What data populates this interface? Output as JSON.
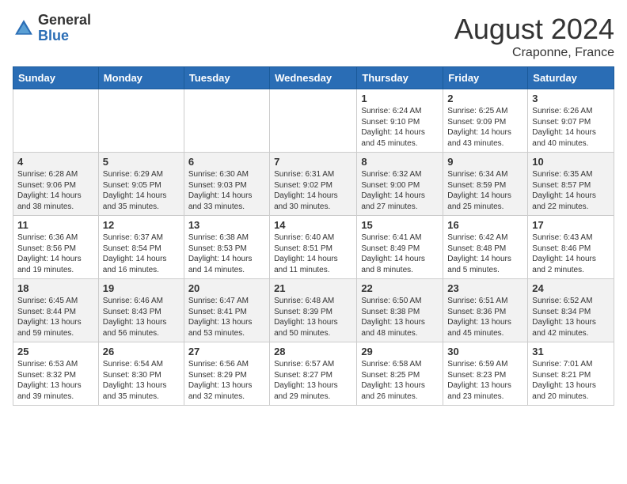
{
  "header": {
    "logo_general": "General",
    "logo_blue": "Blue",
    "month_year": "August 2024",
    "location": "Craponne, France"
  },
  "days_of_week": [
    "Sunday",
    "Monday",
    "Tuesday",
    "Wednesday",
    "Thursday",
    "Friday",
    "Saturday"
  ],
  "weeks": [
    [
      {
        "day": "",
        "content": ""
      },
      {
        "day": "",
        "content": ""
      },
      {
        "day": "",
        "content": ""
      },
      {
        "day": "",
        "content": ""
      },
      {
        "day": "1",
        "content": "Sunrise: 6:24 AM\nSunset: 9:10 PM\nDaylight: 14 hours and 45 minutes."
      },
      {
        "day": "2",
        "content": "Sunrise: 6:25 AM\nSunset: 9:09 PM\nDaylight: 14 hours and 43 minutes."
      },
      {
        "day": "3",
        "content": "Sunrise: 6:26 AM\nSunset: 9:07 PM\nDaylight: 14 hours and 40 minutes."
      }
    ],
    [
      {
        "day": "4",
        "content": "Sunrise: 6:28 AM\nSunset: 9:06 PM\nDaylight: 14 hours and 38 minutes."
      },
      {
        "day": "5",
        "content": "Sunrise: 6:29 AM\nSunset: 9:05 PM\nDaylight: 14 hours and 35 minutes."
      },
      {
        "day": "6",
        "content": "Sunrise: 6:30 AM\nSunset: 9:03 PM\nDaylight: 14 hours and 33 minutes."
      },
      {
        "day": "7",
        "content": "Sunrise: 6:31 AM\nSunset: 9:02 PM\nDaylight: 14 hours and 30 minutes."
      },
      {
        "day": "8",
        "content": "Sunrise: 6:32 AM\nSunset: 9:00 PM\nDaylight: 14 hours and 27 minutes."
      },
      {
        "day": "9",
        "content": "Sunrise: 6:34 AM\nSunset: 8:59 PM\nDaylight: 14 hours and 25 minutes."
      },
      {
        "day": "10",
        "content": "Sunrise: 6:35 AM\nSunset: 8:57 PM\nDaylight: 14 hours and 22 minutes."
      }
    ],
    [
      {
        "day": "11",
        "content": "Sunrise: 6:36 AM\nSunset: 8:56 PM\nDaylight: 14 hours and 19 minutes."
      },
      {
        "day": "12",
        "content": "Sunrise: 6:37 AM\nSunset: 8:54 PM\nDaylight: 14 hours and 16 minutes."
      },
      {
        "day": "13",
        "content": "Sunrise: 6:38 AM\nSunset: 8:53 PM\nDaylight: 14 hours and 14 minutes."
      },
      {
        "day": "14",
        "content": "Sunrise: 6:40 AM\nSunset: 8:51 PM\nDaylight: 14 hours and 11 minutes."
      },
      {
        "day": "15",
        "content": "Sunrise: 6:41 AM\nSunset: 8:49 PM\nDaylight: 14 hours and 8 minutes."
      },
      {
        "day": "16",
        "content": "Sunrise: 6:42 AM\nSunset: 8:48 PM\nDaylight: 14 hours and 5 minutes."
      },
      {
        "day": "17",
        "content": "Sunrise: 6:43 AM\nSunset: 8:46 PM\nDaylight: 14 hours and 2 minutes."
      }
    ],
    [
      {
        "day": "18",
        "content": "Sunrise: 6:45 AM\nSunset: 8:44 PM\nDaylight: 13 hours and 59 minutes."
      },
      {
        "day": "19",
        "content": "Sunrise: 6:46 AM\nSunset: 8:43 PM\nDaylight: 13 hours and 56 minutes."
      },
      {
        "day": "20",
        "content": "Sunrise: 6:47 AM\nSunset: 8:41 PM\nDaylight: 13 hours and 53 minutes."
      },
      {
        "day": "21",
        "content": "Sunrise: 6:48 AM\nSunset: 8:39 PM\nDaylight: 13 hours and 50 minutes."
      },
      {
        "day": "22",
        "content": "Sunrise: 6:50 AM\nSunset: 8:38 PM\nDaylight: 13 hours and 48 minutes."
      },
      {
        "day": "23",
        "content": "Sunrise: 6:51 AM\nSunset: 8:36 PM\nDaylight: 13 hours and 45 minutes."
      },
      {
        "day": "24",
        "content": "Sunrise: 6:52 AM\nSunset: 8:34 PM\nDaylight: 13 hours and 42 minutes."
      }
    ],
    [
      {
        "day": "25",
        "content": "Sunrise: 6:53 AM\nSunset: 8:32 PM\nDaylight: 13 hours and 39 minutes."
      },
      {
        "day": "26",
        "content": "Sunrise: 6:54 AM\nSunset: 8:30 PM\nDaylight: 13 hours and 35 minutes."
      },
      {
        "day": "27",
        "content": "Sunrise: 6:56 AM\nSunset: 8:29 PM\nDaylight: 13 hours and 32 minutes."
      },
      {
        "day": "28",
        "content": "Sunrise: 6:57 AM\nSunset: 8:27 PM\nDaylight: 13 hours and 29 minutes."
      },
      {
        "day": "29",
        "content": "Sunrise: 6:58 AM\nSunset: 8:25 PM\nDaylight: 13 hours and 26 minutes."
      },
      {
        "day": "30",
        "content": "Sunrise: 6:59 AM\nSunset: 8:23 PM\nDaylight: 13 hours and 23 minutes."
      },
      {
        "day": "31",
        "content": "Sunrise: 7:01 AM\nSunset: 8:21 PM\nDaylight: 13 hours and 20 minutes."
      }
    ]
  ]
}
